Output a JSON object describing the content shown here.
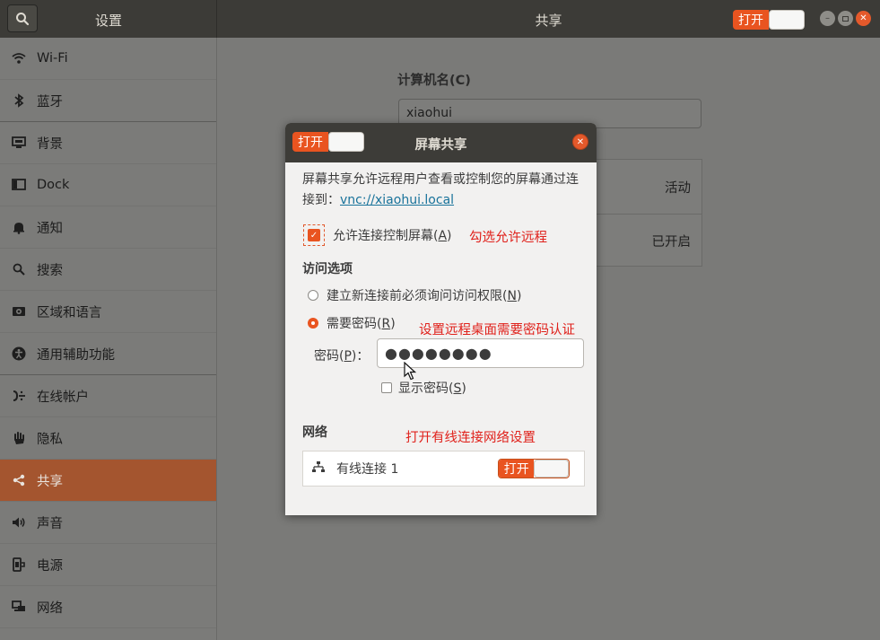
{
  "header": {
    "left_title": "设置",
    "right_title": "共享",
    "master_switch_label": "打开"
  },
  "sidebar": {
    "items": [
      {
        "label": "Wi-Fi",
        "icon": "wifi-icon"
      },
      {
        "label": "蓝牙",
        "icon": "bluetooth-icon"
      },
      {
        "label": "背景",
        "icon": "background-icon"
      },
      {
        "label": "Dock",
        "icon": "dock-icon"
      },
      {
        "label": "通知",
        "icon": "bell-icon"
      },
      {
        "label": "搜索",
        "icon": "search-icon"
      },
      {
        "label": "区域和语言",
        "icon": "region-icon"
      },
      {
        "label": "通用辅助功能",
        "icon": "accessibility-icon"
      },
      {
        "label": "在线帐户",
        "icon": "online-accounts-icon"
      },
      {
        "label": "隐私",
        "icon": "privacy-icon"
      },
      {
        "label": "共享",
        "icon": "share-icon",
        "active": true
      },
      {
        "label": "声音",
        "icon": "sound-icon"
      },
      {
        "label": "电源",
        "icon": "power-icon"
      },
      {
        "label": "网络",
        "icon": "network-icon"
      }
    ]
  },
  "main": {
    "computer_name_label": "计算机名(C)",
    "computer_name_value": "xiaohui",
    "services": [
      {
        "status": "活动"
      },
      {
        "status": "已开启"
      }
    ]
  },
  "dialog": {
    "title": "屏幕共享",
    "switch_label": "打开",
    "description": "屏幕共享允许远程用户查看或控制您的屏幕通过连接到：",
    "link": "vnc://xiaohui.local",
    "allow_control_pre": "允许连接控制屏幕(",
    "allow_control_key": "A",
    "allow_control_post": ")",
    "access_options_label": "访问选项",
    "radio_ask_pre": "建立新连接前必须询问访问权限(",
    "radio_ask_key": "N",
    "radio_ask_post": ")",
    "radio_password_pre": "需要密码(",
    "radio_password_key": "R",
    "radio_password_post": ")",
    "password_label_pre": "密码(",
    "password_label_key": "P",
    "password_label_post": ")：",
    "password_value": "●●●●●●●●",
    "show_password_pre": "显示密码(",
    "show_password_key": "S",
    "show_password_post": ")",
    "network_label": "网络",
    "network_name": "有线连接 1",
    "network_switch_label": "打开"
  },
  "annotations": {
    "allow_remote": "勾选允许远程",
    "password_auth": "设置远程桌面需要密码认证",
    "wired_network": "打开有线连接网络设置"
  },
  "colors": {
    "accent": "#e95420",
    "annotation": "#e0211b",
    "link": "#19739b"
  }
}
